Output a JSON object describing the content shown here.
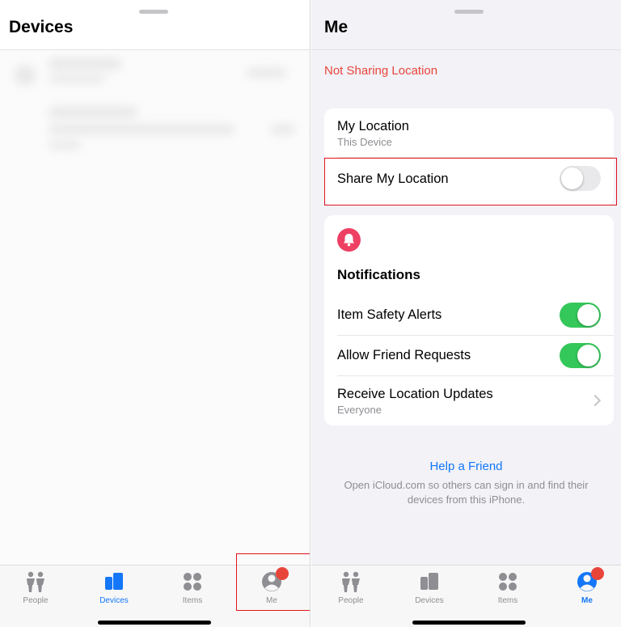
{
  "colors": {
    "accent_blue": "#1477f8",
    "alert_red": "#e8453a",
    "toggle_green": "#34c759",
    "bell_pink": "#ee4062",
    "inactive_gray": "#8e8e93",
    "highlight_red": "#e0141e"
  },
  "left": {
    "title": "Devices"
  },
  "right": {
    "title": "Me",
    "status": "Not Sharing Location",
    "location_card": {
      "my_location_title": "My Location",
      "my_location_sub": "This Device",
      "share_label": "Share My Location",
      "share_enabled": false
    },
    "notifications": {
      "icon": "bell-icon",
      "heading": "Notifications",
      "item_safety_label": "Item Safety Alerts",
      "item_safety_enabled": true,
      "friend_requests_label": "Allow Friend Requests",
      "friend_requests_enabled": true,
      "updates_title": "Receive Location Updates",
      "updates_sub": "Everyone"
    },
    "help": {
      "link": "Help a Friend",
      "text": "Open iCloud.com so others can sign in and find their devices from this iPhone."
    }
  },
  "tabs": [
    {
      "label": "People",
      "icon": "people-icon"
    },
    {
      "label": "Devices",
      "icon": "devices-icon"
    },
    {
      "label": "Items",
      "icon": "items-icon"
    },
    {
      "label": "Me",
      "icon": "me-icon"
    }
  ],
  "left_active_tab": "Devices",
  "right_active_tab": "Me"
}
